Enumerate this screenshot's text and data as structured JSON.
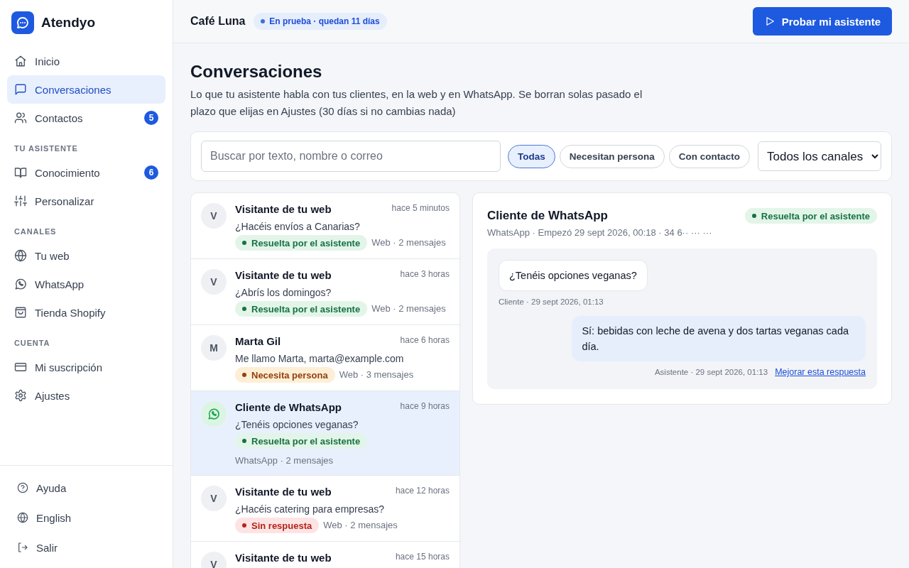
{
  "sidebar": {
    "brand": "Atendyo",
    "sections": [
      {
        "items": [
          {
            "label": "Inicio",
            "selected": false
          },
          {
            "label": "Conversaciones",
            "selected": true
          },
          {
            "label": "Contactos",
            "badge": "5",
            "selected": false
          }
        ]
      },
      {
        "heading": "TU ASISTENTE",
        "items": [
          {
            "label": "Conocimiento",
            "badge": "6",
            "selected": false
          },
          {
            "label": "Personalizar",
            "selected": false
          }
        ]
      },
      {
        "heading": "CANALES",
        "items": [
          {
            "label": "Tu web",
            "selected": false
          },
          {
            "label": "WhatsApp",
            "selected": false
          },
          {
            "label": "Tienda Shopify",
            "selected": false
          }
        ]
      },
      {
        "heading": "CUENTA",
        "items": [
          {
            "label": "Mi suscripción",
            "selected": false
          },
          {
            "label": "Ajustes",
            "selected": false
          }
        ]
      }
    ],
    "footer_items": [
      {
        "label": "Ayuda"
      },
      {
        "label": "English"
      },
      {
        "label": "Salir"
      }
    ]
  },
  "header": {
    "business_name": "Café Luna",
    "trial_badge": "En prueba · quedan 11 días",
    "test_button": "Probar mi asistente"
  },
  "page": {
    "title": "Conversaciones",
    "description": "Lo que tu asistente habla con tus clientes, en la web y en WhatsApp. Se borran solas pasado el plazo que elijas en Ajustes (30 días si no cambias nada)"
  },
  "filters": {
    "search": {
      "placeholder": "Buscar por texto, nombre o correo"
    },
    "chips": [
      {
        "label": "Todas",
        "selected": true
      },
      {
        "label": "Necesitan persona",
        "selected": false
      },
      {
        "label": "Con contacto",
        "selected": false
      }
    ],
    "channel_select": {
      "value": "Todos los canales"
    }
  },
  "conversations": [
    {
      "avatar": {
        "kind": "letter",
        "letter": "V"
      },
      "name": "Visitante de tu web",
      "time": "hace 5 minutos",
      "preview": "¿Hacéis envíos a Canarias?",
      "status": {
        "label": "Resuelta por el asistente",
        "kind": "resolved"
      },
      "meta": "Web · 2 mensajes",
      "selected": false
    },
    {
      "avatar": {
        "kind": "letter",
        "letter": "V"
      },
      "name": "Visitante de tu web",
      "time": "hace 3 horas",
      "preview": "¿Abrís los domingos?",
      "status": {
        "label": "Resuelta por el asistente",
        "kind": "resolved"
      },
      "meta": "Web · 2 mensajes",
      "selected": false
    },
    {
      "avatar": {
        "kind": "letter",
        "letter": "M"
      },
      "name": "Marta Gil",
      "time": "hace 6 horas",
      "preview": "Me llamo Marta, marta@example.com",
      "status": {
        "label": "Necesita persona",
        "kind": "needs_person"
      },
      "meta": "Web · 3 mensajes",
      "selected": false
    },
    {
      "avatar": {
        "kind": "channel"
      },
      "name": "Cliente de WhatsApp",
      "time": "hace 9 horas",
      "preview": "¿Tenéis opciones veganas?",
      "status": {
        "label": "Resuelta por el asistente",
        "kind": "resolved"
      },
      "meta": "WhatsApp · 2 mensajes",
      "selected": true
    },
    {
      "avatar": {
        "kind": "letter",
        "letter": "V"
      },
      "name": "Visitante de tu web",
      "time": "hace 12 horas",
      "preview": "¿Hacéis catering para empresas?",
      "status": {
        "label": "Sin respuesta",
        "kind": "unanswered"
      },
      "meta": "Web · 2 mensajes",
      "selected": false
    },
    {
      "avatar": {
        "kind": "letter",
        "letter": "V"
      },
      "name": "Visitante de tu web",
      "time": "hace 15 horas",
      "selected": false
    }
  ],
  "detail": {
    "title": "Cliente de WhatsApp",
    "status": {
      "label": "Resuelta por el asistente",
      "kind": "resolved"
    },
    "meta": "WhatsApp · Empezó 29 sept 2026, 00:18 · 34 6·· ··· ···",
    "messages": [
      {
        "kind": "customer",
        "text": "¿Tenéis opciones veganas?",
        "meta": "Cliente · 29 sept 2026, 01:13"
      },
      {
        "kind": "assistant",
        "text": "Sí: bebidas con leche de avena y dos tartas veganas cada día.",
        "meta": "Asistente · 29 sept 2026, 01:13",
        "action": "Mejorar esta respuesta"
      }
    ]
  }
}
